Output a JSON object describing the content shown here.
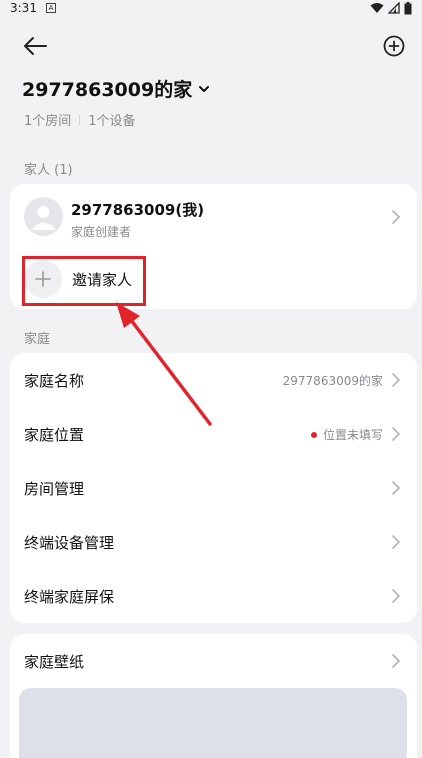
{
  "status_bar": {
    "time": "3:31",
    "notification_badge": "A"
  },
  "header": {
    "back_icon": "back-arrow-icon",
    "add_icon": "plus-circle-icon"
  },
  "home": {
    "title": "2977863009的家",
    "room_count": "1个房间",
    "device_count": "1个设备"
  },
  "family_section": {
    "label": "家人 (1)",
    "member": {
      "name": "2977863009(我)",
      "role": "家庭创建者"
    },
    "invite_label": "邀请家人"
  },
  "home_section": {
    "label": "家庭",
    "rows": [
      {
        "label": "家庭名称",
        "value": "2977863009的家"
      },
      {
        "label": "家庭位置",
        "value": "位置未填写"
      },
      {
        "label": "房间管理",
        "value": ""
      },
      {
        "label": "终端设备管理",
        "value": ""
      },
      {
        "label": "终端家庭屏保",
        "value": ""
      }
    ]
  },
  "wallpaper_section": {
    "label": "家庭壁纸"
  },
  "colors": {
    "highlight": "#e3232a",
    "background": "#f2f2f4",
    "card": "#ffffff"
  }
}
